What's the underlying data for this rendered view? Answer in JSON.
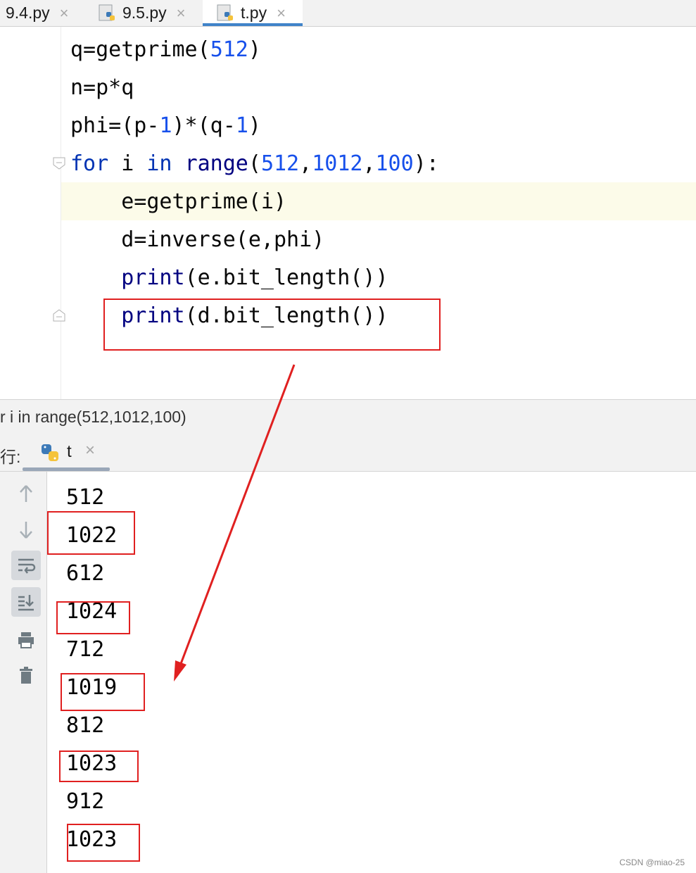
{
  "tabs": [
    {
      "label": "9.4.py",
      "close": "×"
    },
    {
      "label": "9.5.py",
      "close": "×"
    },
    {
      "label": "t.py",
      "close": "×",
      "active": true
    }
  ],
  "editor": {
    "lines": [
      "q=getprime(512)",
      "n=p*q",
      "phi=(p-1)*(q-1)",
      "for i in range(512,1012,100):",
      "    e=getprime(i)",
      "    d=inverse(e,phi)",
      "    print(e.bit_length())",
      "    print(d.bit_length())"
    ]
  },
  "breadcrumb": "r i in range(512,1012,100)",
  "run": {
    "label": "行:",
    "tab_name": "t",
    "tab_close": "×"
  },
  "console": {
    "output": [
      "512",
      "1022",
      "612",
      "1024",
      "712",
      "1019",
      "812",
      "1023",
      "912",
      "1023"
    ]
  },
  "icons": {
    "up": "arrow-up-icon",
    "down": "arrow-down-icon",
    "wrap": "soft-wrap-icon",
    "scroll": "scroll-to-end-icon",
    "print": "print-icon",
    "trash": "trash-icon"
  },
  "watermark": "CSDN @miao-25",
  "colors": {
    "annotation": "#e02020",
    "keyword": "#0033b3",
    "number": "#1750eb",
    "tab_underline": "#4083c9"
  }
}
